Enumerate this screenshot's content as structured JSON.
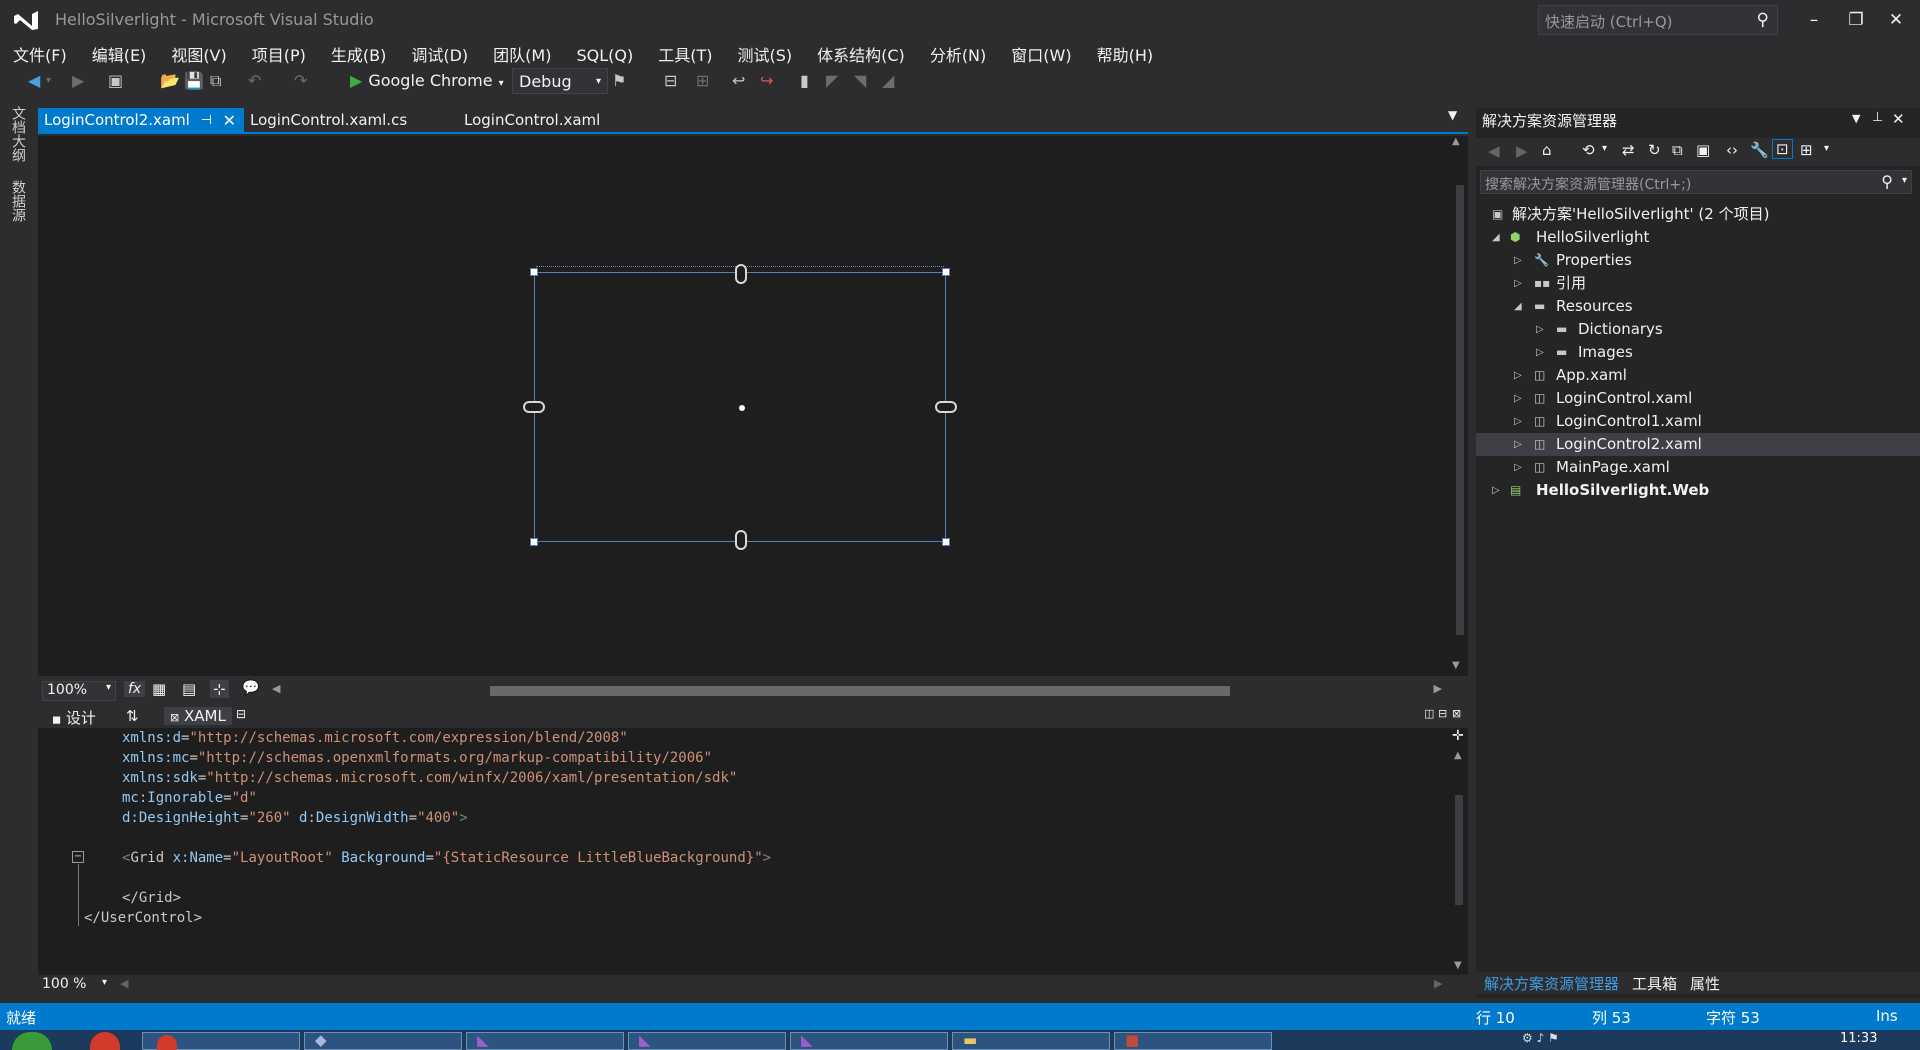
{
  "window": {
    "title": "HelloSilverlight - Microsoft Visual Studio",
    "quick_launch_placeholder": "快速启动 (Ctrl+Q)"
  },
  "menu": [
    "文件(F)",
    "编辑(E)",
    "视图(V)",
    "项目(P)",
    "生成(B)",
    "调试(D)",
    "团队(M)",
    "SQL(Q)",
    "工具(T)",
    "测试(S)",
    "体系结构(C)",
    "分析(N)",
    "窗口(W)",
    "帮助(H)"
  ],
  "toolbar": {
    "run_target": "Google Chrome",
    "configuration": "Debug"
  },
  "left_strip": {
    "doc_outline": "文档大纲",
    "data_sources": "数据源"
  },
  "doc_tabs": [
    {
      "label": "LoginControl2.xaml",
      "active": true
    },
    {
      "label": "LoginControl.xaml.cs"
    },
    {
      "label": "LoginControl.xaml"
    }
  ],
  "designer": {
    "zoom": "100%",
    "fx_label": "fx"
  },
  "split": {
    "design": "设计",
    "swap": "⇅",
    "xaml": "XAML"
  },
  "code": {
    "lines": [
      {
        "a": "xmlns:d",
        "v": "\"http://schemas.microsoft.com/expression/blend/2008\""
      },
      {
        "a": "xmlns:mc",
        "v": "\"http://schemas.openxmlformats.org/markup-compatibility/2006\""
      },
      {
        "a": "xmlns:sdk",
        "v": "\"http://schemas.microsoft.com/winfx/2006/xaml/presentation/sdk\""
      },
      {
        "a": "mc:Ignorable",
        "v": "\"d\""
      },
      {
        "a": "d:DesignHeight",
        "v": "\"260\"",
        "a2": " d:DesignWidth",
        "v2": "\"400\"",
        "end": ">"
      }
    ],
    "grid_open": {
      "lt": "<",
      "tag": "Grid",
      "a1": " x:Name",
      "v1": "\"LayoutRoot\"",
      "a2": " Background",
      "v2": "\"{StaticResource LittleBlueBackground}\"",
      "gt": ">"
    },
    "grid_close": "</Grid>",
    "usercontrol_close": "</UserControl>",
    "zoom": "100 %"
  },
  "solution_explorer": {
    "title": "解决方案资源管理器",
    "search_placeholder": "搜索解决方案资源管理器(Ctrl+;)",
    "items": [
      {
        "label": "解决方案'HelloSilverlight' (2 个项目)"
      },
      {
        "label": "HelloSilverlight"
      },
      {
        "label": "Properties"
      },
      {
        "label": "引用"
      },
      {
        "label": "Resources"
      },
      {
        "label": "Dictionarys"
      },
      {
        "label": "Images"
      },
      {
        "label": "App.xaml"
      },
      {
        "label": "LoginControl.xaml"
      },
      {
        "label": "LoginControl1.xaml"
      },
      {
        "label": "LoginControl2.xaml"
      },
      {
        "label": "MainPage.xaml"
      },
      {
        "label": "HelloSilverlight.Web"
      }
    ],
    "tabs": [
      "解决方案资源管理器",
      "工具箱",
      "属性"
    ]
  },
  "status": {
    "ready": "就绪",
    "line": "行 10",
    "col": "列 53",
    "char": "字符 53",
    "mode": "Ins"
  },
  "taskbar": {
    "clock": "11:33"
  },
  "colors": {
    "accent": "#007acc",
    "background": "#2d2d30",
    "editor": "#1e1e1e"
  }
}
